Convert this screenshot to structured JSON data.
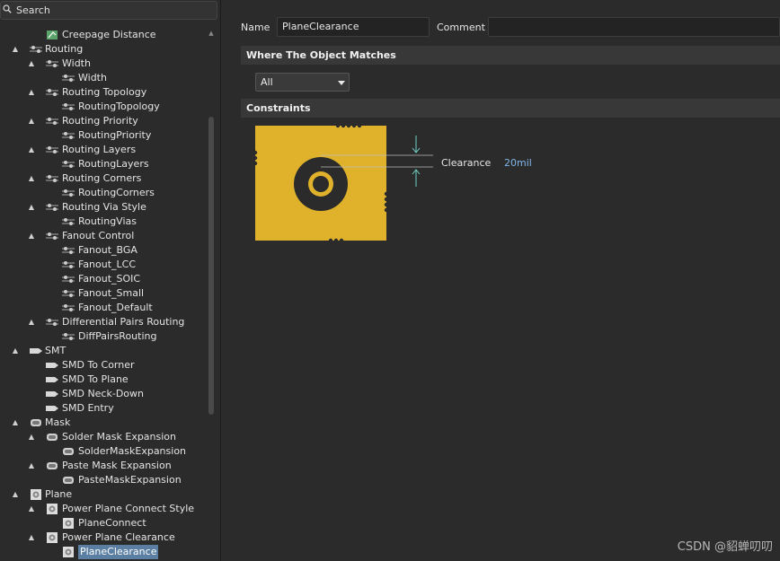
{
  "search": {
    "placeholder": "Search"
  },
  "tree": [
    {
      "label": "Creepage Distance",
      "level": 2,
      "twisty": "",
      "icon": "rule-icon"
    },
    {
      "label": "Routing",
      "level": 1,
      "twisty": "▲",
      "icon": "routing-icon"
    },
    {
      "label": "Width",
      "level": 2,
      "twisty": "▲",
      "icon": "routing-icon"
    },
    {
      "label": "Width",
      "level": 3,
      "twisty": "",
      "icon": "routing-icon"
    },
    {
      "label": "Routing Topology",
      "level": 2,
      "twisty": "▲",
      "icon": "routing-icon"
    },
    {
      "label": "RoutingTopology",
      "level": 3,
      "twisty": "",
      "icon": "routing-icon"
    },
    {
      "label": "Routing Priority",
      "level": 2,
      "twisty": "▲",
      "icon": "routing-icon"
    },
    {
      "label": "RoutingPriority",
      "level": 3,
      "twisty": "",
      "icon": "routing-icon"
    },
    {
      "label": "Routing Layers",
      "level": 2,
      "twisty": "▲",
      "icon": "routing-icon"
    },
    {
      "label": "RoutingLayers",
      "level": 3,
      "twisty": "",
      "icon": "routing-icon"
    },
    {
      "label": "Routing Corners",
      "level": 2,
      "twisty": "▲",
      "icon": "routing-icon"
    },
    {
      "label": "RoutingCorners",
      "level": 3,
      "twisty": "",
      "icon": "routing-icon"
    },
    {
      "label": "Routing Via Style",
      "level": 2,
      "twisty": "▲",
      "icon": "routing-icon"
    },
    {
      "label": "RoutingVias",
      "level": 3,
      "twisty": "",
      "icon": "routing-icon"
    },
    {
      "label": "Fanout Control",
      "level": 2,
      "twisty": "▲",
      "icon": "routing-icon"
    },
    {
      "label": "Fanout_BGA",
      "level": 3,
      "twisty": "",
      "icon": "routing-icon"
    },
    {
      "label": "Fanout_LCC",
      "level": 3,
      "twisty": "",
      "icon": "routing-icon"
    },
    {
      "label": "Fanout_SOIC",
      "level": 3,
      "twisty": "",
      "icon": "routing-icon"
    },
    {
      "label": "Fanout_Small",
      "level": 3,
      "twisty": "",
      "icon": "routing-icon"
    },
    {
      "label": "Fanout_Default",
      "level": 3,
      "twisty": "",
      "icon": "routing-icon"
    },
    {
      "label": "Differential Pairs Routing",
      "level": 2,
      "twisty": "▲",
      "icon": "routing-icon"
    },
    {
      "label": "DiffPairsRouting",
      "level": 3,
      "twisty": "",
      "icon": "routing-icon"
    },
    {
      "label": "SMT",
      "level": 1,
      "twisty": "▲",
      "icon": "smt-icon"
    },
    {
      "label": "SMD To Corner",
      "level": 2,
      "twisty": "",
      "icon": "smt-icon"
    },
    {
      "label": "SMD To Plane",
      "level": 2,
      "twisty": "",
      "icon": "smt-icon"
    },
    {
      "label": "SMD Neck-Down",
      "level": 2,
      "twisty": "",
      "icon": "smt-icon"
    },
    {
      "label": "SMD Entry",
      "level": 2,
      "twisty": "",
      "icon": "smt-icon"
    },
    {
      "label": "Mask",
      "level": 1,
      "twisty": "▲",
      "icon": "mask-icon"
    },
    {
      "label": "Solder Mask Expansion",
      "level": 2,
      "twisty": "▲",
      "icon": "mask-icon"
    },
    {
      "label": "SolderMaskExpansion",
      "level": 3,
      "twisty": "",
      "icon": "mask-icon"
    },
    {
      "label": "Paste Mask Expansion",
      "level": 2,
      "twisty": "▲",
      "icon": "mask-icon"
    },
    {
      "label": "PasteMaskExpansion",
      "level": 3,
      "twisty": "",
      "icon": "mask-icon"
    },
    {
      "label": "Plane",
      "level": 1,
      "twisty": "▲",
      "icon": "plane-icon"
    },
    {
      "label": "Power Plane Connect Style",
      "level": 2,
      "twisty": "▲",
      "icon": "plane-icon"
    },
    {
      "label": "PlaneConnect",
      "level": 3,
      "twisty": "",
      "icon": "plane-icon"
    },
    {
      "label": "Power Plane Clearance",
      "level": 2,
      "twisty": "▲",
      "icon": "plane-icon"
    },
    {
      "label": "PlaneClearance",
      "level": 3,
      "twisty": "",
      "icon": "plane-icon",
      "selected": true
    }
  ],
  "form": {
    "name_label": "Name",
    "name_value": "PlaneClearance",
    "comment_label": "Comment",
    "comment_value": ""
  },
  "where": {
    "title": "Where The Object Matches",
    "selected": "All"
  },
  "constraints": {
    "title": "Constraints",
    "clearance_label": "Clearance",
    "clearance_value": "20mil"
  },
  "colors": {
    "plane_fill": "#e0b22c",
    "value_text": "#7fb6ea",
    "selection": "#5b7fa3"
  },
  "watermark": "CSDN @貂蝉叨叨"
}
